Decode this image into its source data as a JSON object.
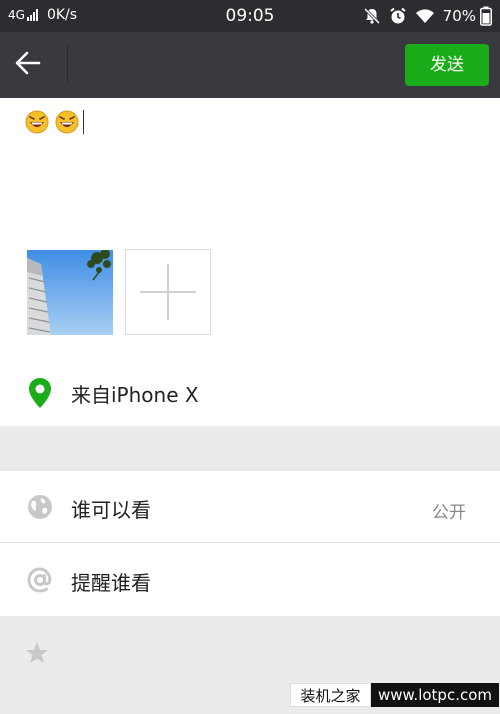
{
  "status_bar": {
    "network": "4G",
    "speed": "0K/s",
    "time": "09:05",
    "battery": "70%",
    "icons": [
      "signal-icon",
      "mute-bell-icon",
      "alarm-icon",
      "wifi-icon"
    ]
  },
  "nav": {
    "back_icon": "back-arrow-icon",
    "send_label": "发送"
  },
  "compose": {
    "emojis": [
      "grinning-emoji",
      "grinning-emoji"
    ],
    "photos": [
      {
        "kind": "sky-building-photo"
      }
    ],
    "add_photo_icon": "plus-icon"
  },
  "location": {
    "icon": "location-pin-icon",
    "text": "来自iPhone X"
  },
  "visibility": {
    "icon": "globe-icon",
    "label": "谁可以看",
    "value": "公开"
  },
  "remind": {
    "icon": "at-icon",
    "label": "提醒谁看"
  },
  "bottom": {
    "icon": "star-icon"
  },
  "watermark": {
    "left_text": "装机之家",
    "right_text": "www.lotpc.com"
  },
  "colors": {
    "status_bar_bg": "#2b2d30",
    "nav_bg": "#393a3f",
    "send_button": "#1aad19",
    "location_pin": "#1aad19",
    "section_gap": "#ebebeb"
  }
}
